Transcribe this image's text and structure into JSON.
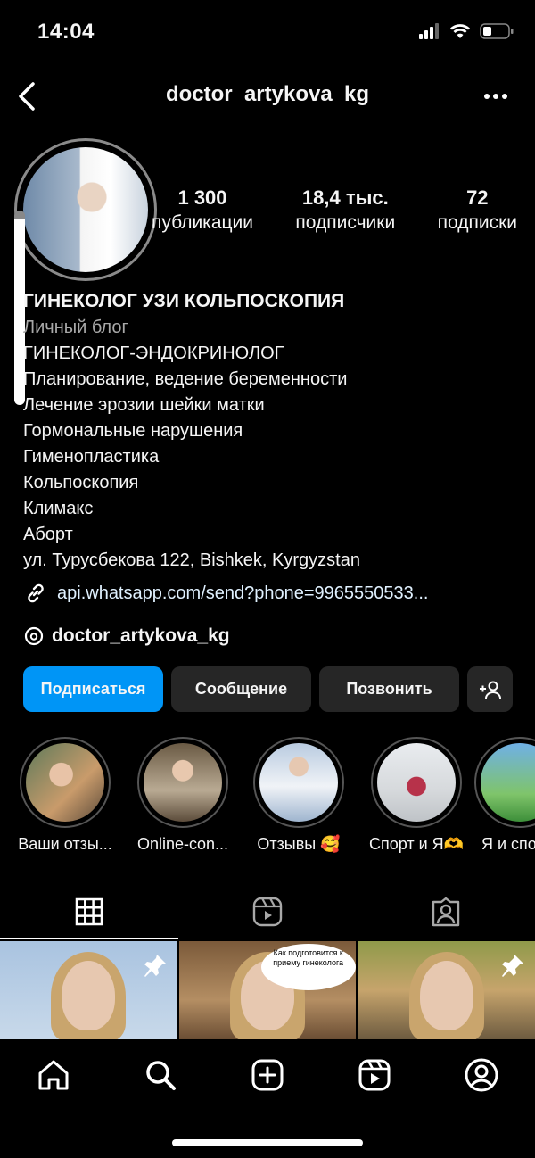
{
  "status_bar": {
    "time": "14:04"
  },
  "header": {
    "username": "doctor_artykova_kg"
  },
  "stats": [
    {
      "value": "1 300",
      "label": "публикации"
    },
    {
      "value": "18,4 тыс.",
      "label": "подписчики"
    },
    {
      "value": "72",
      "label": "подписки"
    }
  ],
  "bio": {
    "name": "ГИНЕКОЛОГ УЗИ КОЛЬПОСКОПИЯ",
    "category": "Личный блог",
    "lines": [
      "ГИНЕКОЛОГ-ЭНДОКРИНОЛОГ",
      "Планирование, ведение беременности",
      "Лечение эрозии шейки матки",
      "Гормональные нарушения",
      "Гименопластика",
      "Кольпоскопия",
      "Климакс",
      "Аборт",
      "ул. Турусбекова 122, Bishkek, Kyrgyzstan"
    ],
    "link": "api.whatsapp.com/send?phone=9965550533...",
    "threads": "doctor_artykova_kg"
  },
  "buttons": {
    "follow": "Подписаться",
    "message": "Сообщение",
    "call": "Позвонить"
  },
  "highlights": [
    {
      "label": "Ваши отзы..."
    },
    {
      "label": "Online-con..."
    },
    {
      "label": "Отзывы 🥰"
    },
    {
      "label": "Спорт и Я🫶"
    },
    {
      "label": "Я и спо"
    }
  ],
  "grid": {
    "bubble_text": "Как подготовится к приему гинеколога"
  },
  "colors": {
    "accent": "#0095f6",
    "background": "#000000",
    "button": "#262626"
  },
  "icons": {
    "back": "chevron-left-icon",
    "more": "more-horizontal-icon",
    "link": "link-icon",
    "threads": "threads-icon",
    "add_user": "add-user-icon",
    "grid_tab": "grid-icon",
    "reels_tab": "reels-icon",
    "tagged_tab": "tagged-icon",
    "home": "home-icon",
    "search": "search-icon",
    "create": "plus-square-icon",
    "reels": "reels-icon",
    "profile": "profile-icon"
  }
}
